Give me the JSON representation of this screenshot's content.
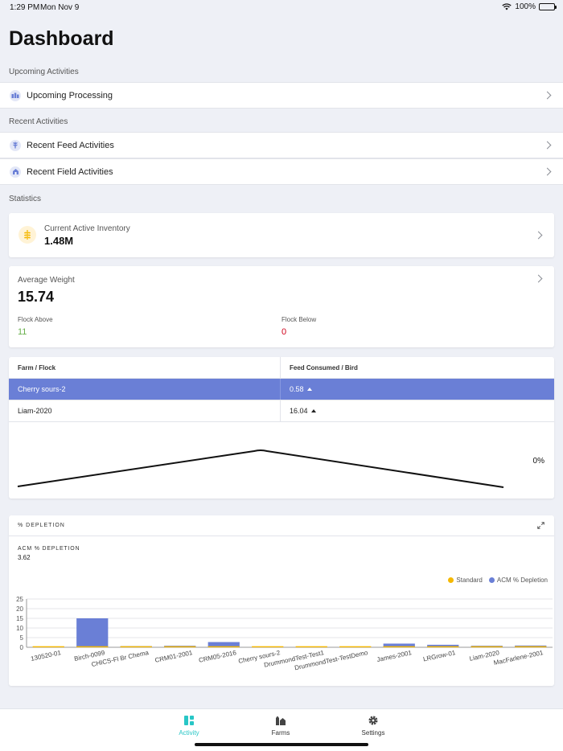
{
  "status_bar": {
    "time": "1:29 PM",
    "date": "Mon Nov 9",
    "battery": "100%"
  },
  "page_title": "Dashboard",
  "sections": {
    "upcoming": "Upcoming Activities",
    "recent": "Recent Activities",
    "statistics": "Statistics"
  },
  "upcoming_items": [
    {
      "label": "Upcoming Processing",
      "icon": "processing-icon"
    }
  ],
  "recent_items": [
    {
      "label": "Recent Feed Activities",
      "icon": "feed-icon"
    },
    {
      "label": "Recent Field Activities",
      "icon": "field-icon"
    }
  ],
  "inventory": {
    "label": "Current Active Inventory",
    "value": "1.48M",
    "icon": "wheat-icon"
  },
  "average_weight": {
    "label": "Average Weight",
    "value": "15.74",
    "flock_above_label": "Flock Above",
    "flock_above_value": "11",
    "flock_below_label": "Flock Below",
    "flock_below_value": "0"
  },
  "feed_table": {
    "col1": "Farm / Flock",
    "col2": "Feed Consumed / Bird",
    "rows": [
      {
        "flock": "Cherry sours-2",
        "value": "0.58",
        "selected": true
      },
      {
        "flock": "Liam-2020",
        "value": "16.04",
        "selected": false
      }
    ],
    "sparkline_label": "0%"
  },
  "depletion": {
    "title": "% DEPLETION",
    "acm_label": "ACM % DEPLETION",
    "acm_value": "3.62"
  },
  "chart_data": {
    "type": "bar",
    "categories": [
      "130520-01",
      "Birch-0099",
      "CHICS-Fl Br Chema",
      "CRM01-2001",
      "CRM05-2016",
      "Cherry sours-2",
      "DrummondTest-Test1",
      "DrummondTest-TestDemo",
      "James-2001",
      "LRGrow-01",
      "Liam-2020",
      "MacFarlene-2001"
    ],
    "series": [
      {
        "name": "Standard",
        "color": "#f5b800",
        "values": [
          0.3,
          0.3,
          0.3,
          0.3,
          0.3,
          0.3,
          0.3,
          0.3,
          0.3,
          0.3,
          0.3,
          0.3
        ]
      },
      {
        "name": "ACM % Depletion",
        "color": "#6a7fd6",
        "values": [
          0,
          15,
          0.6,
          0.8,
          2.7,
          0,
          0,
          0,
          1.9,
          1.3,
          0.8,
          0.9
        ]
      }
    ],
    "ylim": [
      0,
      25
    ],
    "yticks": [
      0,
      5,
      10,
      15,
      20,
      25
    ],
    "legend": "top-right",
    "grid": true
  },
  "tabs": [
    {
      "label": "Activity",
      "icon": "activity-icon",
      "active": true
    },
    {
      "label": "Farms",
      "icon": "farms-icon",
      "active": false
    },
    {
      "label": "Settings",
      "icon": "gear-icon",
      "active": false
    }
  ],
  "colors": {
    "accent": "#6a7fd6",
    "tab_active": "#28c6c6",
    "positive": "#6ab04c",
    "negative": "#d0021b"
  }
}
